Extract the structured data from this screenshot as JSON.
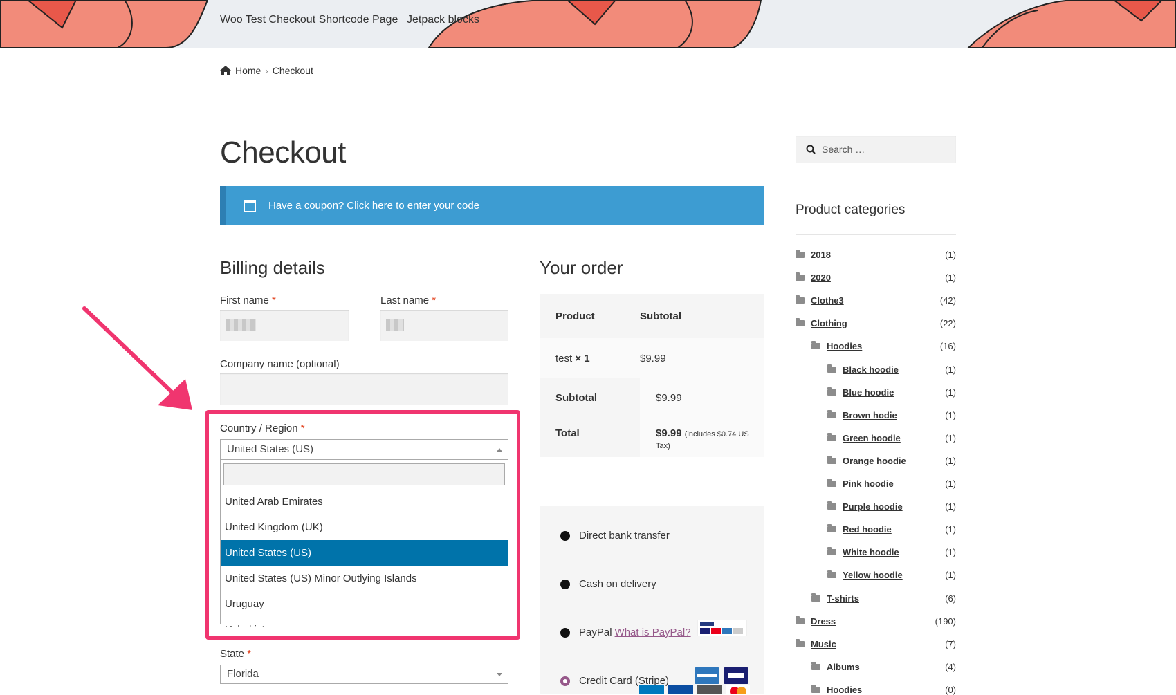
{
  "header": {
    "nav": [
      "Woo Test Checkout Shortcode Page",
      "Jetpack blocks"
    ]
  },
  "breadcrumb": {
    "home": "Home",
    "sep": "›",
    "current": "Checkout"
  },
  "page_title": "Checkout",
  "coupon": {
    "text": "Have a coupon?",
    "link": "Click here to enter your code"
  },
  "billing": {
    "title": "Billing details",
    "first_name_label": "First name",
    "last_name_label": "Last name",
    "company_label": "Company name (optional)",
    "country_label": "Country / Region",
    "required_mark": "*",
    "country_selected": "United States (US)",
    "country_options": [
      "United Arab Emirates",
      "United Kingdom (UK)",
      "United States (US)",
      "United States (US) Minor Outlying Islands",
      "Uruguay",
      "Uzbekistan"
    ],
    "state_label": "State",
    "state_value": "Florida"
  },
  "order": {
    "title": "Your order",
    "col_product": "Product",
    "col_subtotal": "Subtotal",
    "item_name": "test",
    "item_qty": "× 1",
    "item_price": "$9.99",
    "subtotal_label": "Subtotal",
    "subtotal_value": "$9.99",
    "total_label": "Total",
    "total_value": "$9.99",
    "total_tax": "(includes $0.74 US Tax)"
  },
  "payment": {
    "bank": "Direct bank transfer",
    "cod": "Cash on delivery",
    "paypal": "PayPal",
    "paypal_link": "What is PayPal?",
    "stripe": "Credit Card (Stripe)"
  },
  "sidebar": {
    "search_placeholder": "Search …",
    "categories_title": "Product categories",
    "categories": [
      {
        "name": "2018",
        "count": "(1)",
        "level": 0
      },
      {
        "name": "2020",
        "count": "(1)",
        "level": 0
      },
      {
        "name": "Clothe3",
        "count": "(42)",
        "level": 0
      },
      {
        "name": "Clothing",
        "count": "(22)",
        "level": 0
      },
      {
        "name": "Hoodies",
        "count": "(16)",
        "level": 1
      },
      {
        "name": "Black hoodie",
        "count": "(1)",
        "level": 2
      },
      {
        "name": "Blue hoodie",
        "count": "(1)",
        "level": 2
      },
      {
        "name": "Brown hodie",
        "count": "(1)",
        "level": 2
      },
      {
        "name": "Green hoodie",
        "count": "(1)",
        "level": 2
      },
      {
        "name": "Orange hoodie",
        "count": "(1)",
        "level": 2
      },
      {
        "name": "Pink hoodie",
        "count": "(1)",
        "level": 2
      },
      {
        "name": "Purple hoodie",
        "count": "(1)",
        "level": 2
      },
      {
        "name": "Red hoodie",
        "count": "(1)",
        "level": 2
      },
      {
        "name": "White hoodie",
        "count": "(1)",
        "level": 2
      },
      {
        "name": "Yellow hoodie",
        "count": "(1)",
        "level": 2
      },
      {
        "name": "T-shirts",
        "count": "(6)",
        "level": 1
      },
      {
        "name": "Dress",
        "count": "(190)",
        "level": 0
      },
      {
        "name": "Music",
        "count": "(7)",
        "level": 0
      },
      {
        "name": "Albums",
        "count": "(4)",
        "level": 1
      },
      {
        "name": "Hoodies",
        "count": "(0)",
        "level": 1
      }
    ]
  },
  "colors": {
    "accent": "#3d9cd2",
    "highlight": "#f0356f",
    "selected": "#0073aa",
    "link_purple": "#96588a"
  }
}
